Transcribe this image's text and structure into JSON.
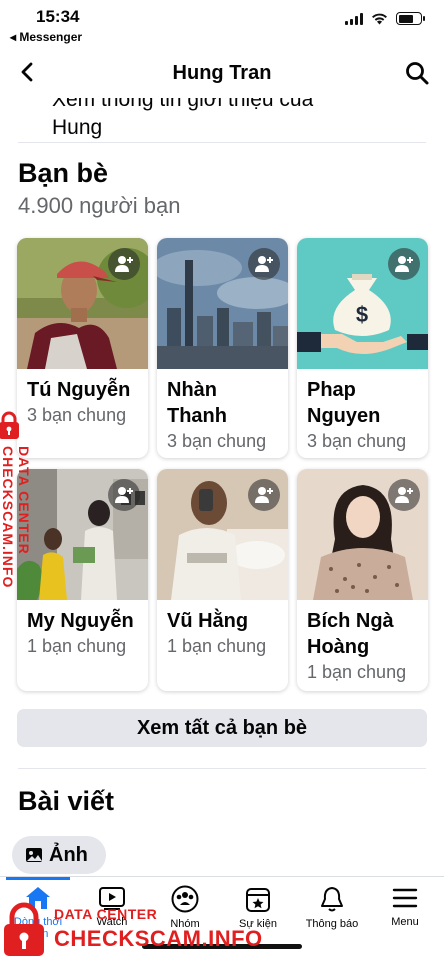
{
  "status_bar": {
    "time": "15:34",
    "back_app": "◂ Messenger",
    "battery_level": 0.7
  },
  "nav": {
    "title": "Hung Tran"
  },
  "intro": {
    "cut_line": "Xem thông tin giới thiệu của",
    "name_line": "Hung"
  },
  "friends": {
    "title": "Bạn bè",
    "count": "4.900 người bạn",
    "see_all": "Xem tất cả bạn bè",
    "items": [
      {
        "name": "Tú Nguyễn",
        "mutual": "3 bạn chung",
        "photo": "man-with-cap-photo"
      },
      {
        "name": "Nhàn Thanh",
        "mutual": "3 bạn chung",
        "photo": "city-skyline-photo"
      },
      {
        "name": "Phap Nguyen",
        "mutual": "3 bạn chung",
        "photo": "money-bag-illustration"
      },
      {
        "name": "My Nguyễn",
        "mutual": "1 bạn chung",
        "photo": "people-in-room-photo"
      },
      {
        "name": "Vũ Hằng",
        "mutual": "1 bạn chung",
        "photo": "girl-mirror-selfie-photo"
      },
      {
        "name": "Bích Ngà Hoàng",
        "mutual": "1 bạn chung",
        "photo": "girl-portrait-photo"
      }
    ]
  },
  "posts": {
    "title": "Bài viết",
    "photos_chip": "Ảnh"
  },
  "tabbar": {
    "items": [
      {
        "label": "Dòng thời gian",
        "icon": "home-icon",
        "active": true
      },
      {
        "label": "Watch",
        "icon": "watch-icon"
      },
      {
        "label": "Nhóm",
        "icon": "groups-icon"
      },
      {
        "label": "Sự kiện",
        "icon": "events-icon"
      },
      {
        "label": "Thông báo",
        "icon": "bell-icon"
      },
      {
        "label": "Menu",
        "icon": "menu-icon"
      }
    ]
  },
  "watermark": {
    "line1": "DATA CENTER",
    "line2": "CHECKSCAM.INFO",
    "side": "DATA CENTER CHECKSCAM.INFO"
  }
}
